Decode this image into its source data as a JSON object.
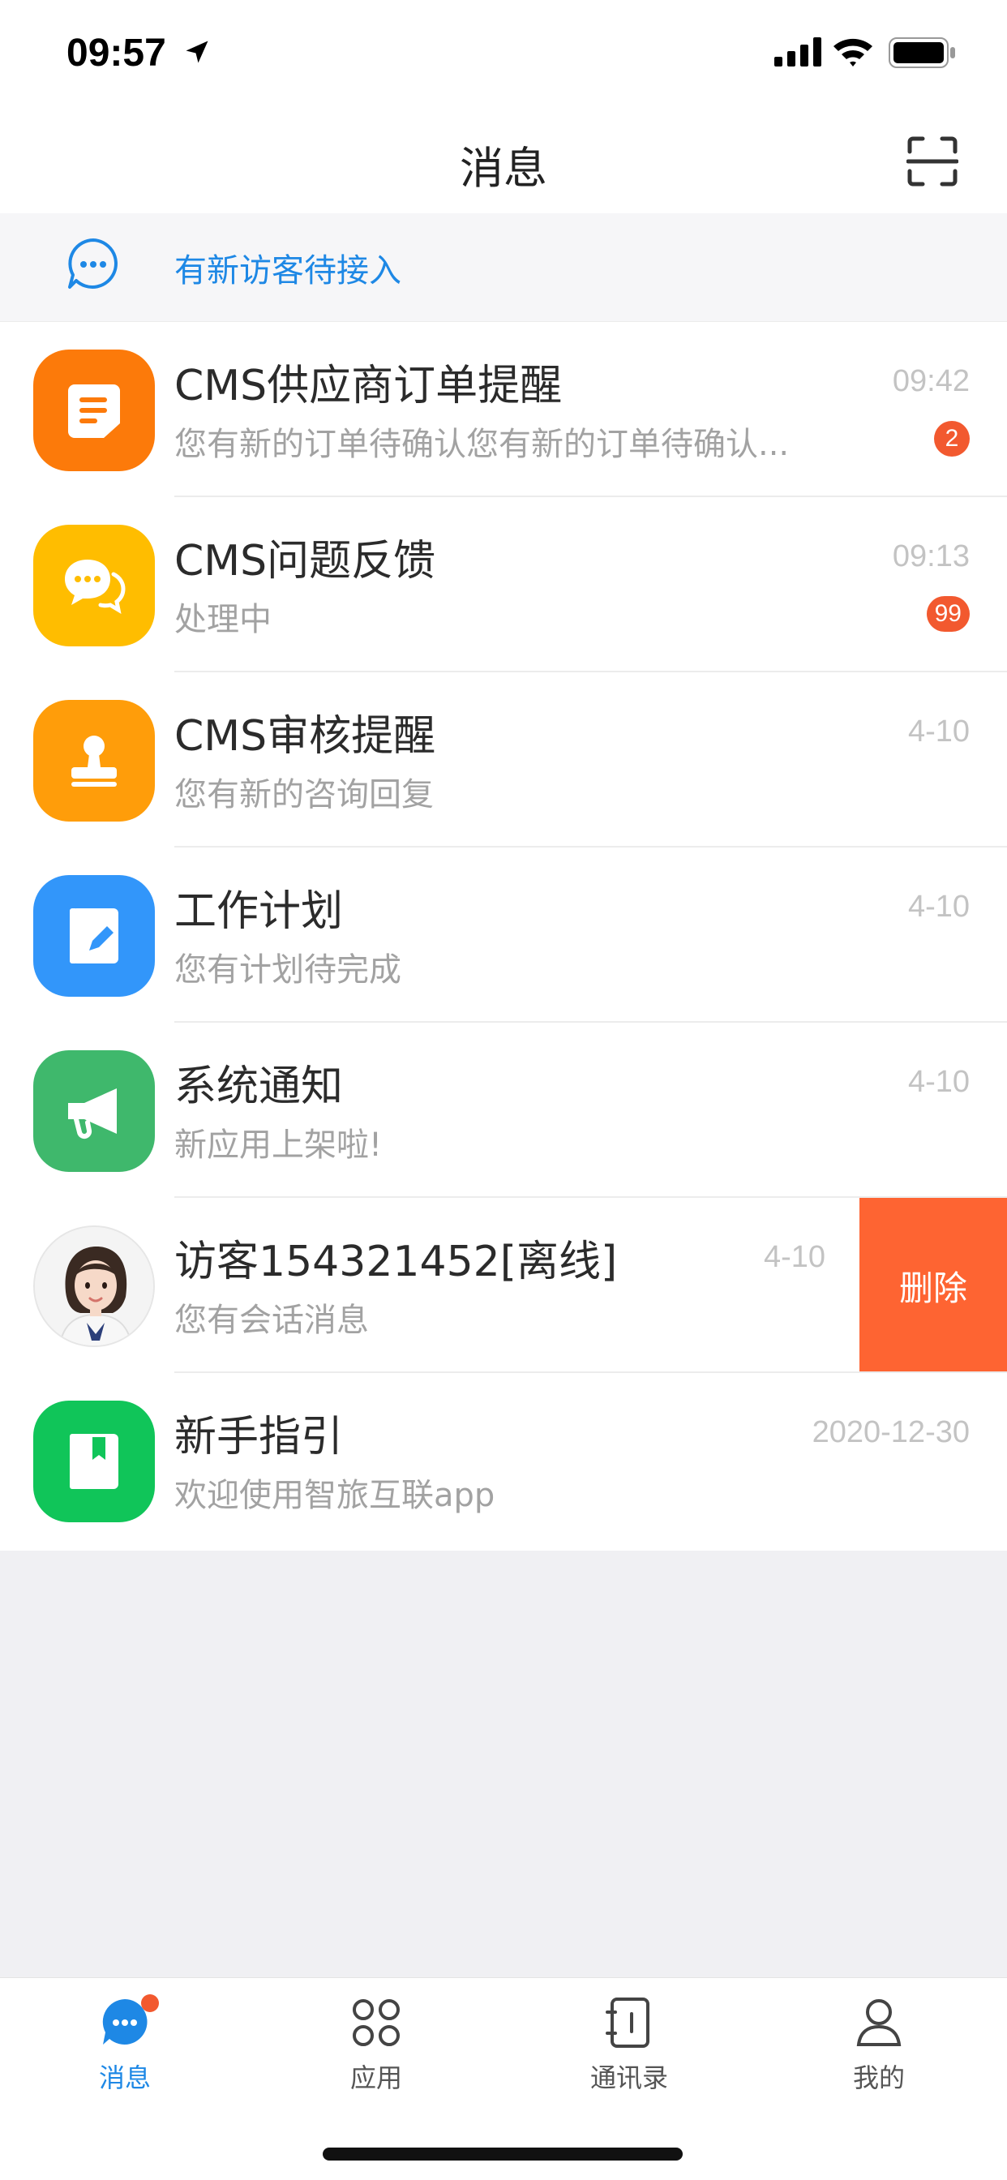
{
  "status_bar": {
    "time": "09:57"
  },
  "header": {
    "title": "消息"
  },
  "visitor_banner": {
    "text": "有新访客待接入"
  },
  "messages": [
    {
      "title": "CMS供应商订单提醒",
      "subtitle": "您有新的订单待确认您有新的订单待确认...",
      "time": "09:42",
      "badge": "2",
      "icon": "document-icon",
      "color": "#fc7a0a"
    },
    {
      "title": "CMS问题反馈",
      "subtitle": "处理中",
      "time": "09:13",
      "badge": "99",
      "icon": "chat-bubbles-icon",
      "color": "#ffbd00"
    },
    {
      "title": "CMS审核提醒",
      "subtitle": "您有新的咨询回复",
      "time": "4-10",
      "icon": "stamp-icon",
      "color": "#ff9d0a"
    },
    {
      "title": "工作计划",
      "subtitle": "您有计划待完成",
      "time": "4-10",
      "icon": "notebook-pen-icon",
      "color": "#3296fa"
    },
    {
      "title": "系统通知",
      "subtitle": "新应用上架啦!",
      "time": "4-10",
      "icon": "megaphone-icon",
      "color": "#3fb86c"
    },
    {
      "title": "访客154321452[离线]",
      "subtitle": "您有会话消息",
      "time": "4-10",
      "icon": "visitor-avatar",
      "delete_label": "删除"
    },
    {
      "title": "新手指引",
      "subtitle": "欢迎使用智旅互联app",
      "time": "2020-12-30",
      "icon": "book-icon",
      "color": "#10c559"
    }
  ],
  "tabs": [
    {
      "label": "消息",
      "icon": "message-icon",
      "active": true
    },
    {
      "label": "应用",
      "icon": "apps-icon"
    },
    {
      "label": "通讯录",
      "icon": "contacts-icon"
    },
    {
      "label": "我的",
      "icon": "profile-icon"
    }
  ],
  "colors": {
    "accent": "#1e88e5",
    "badge": "#f2592f",
    "delete": "#fe6432"
  }
}
